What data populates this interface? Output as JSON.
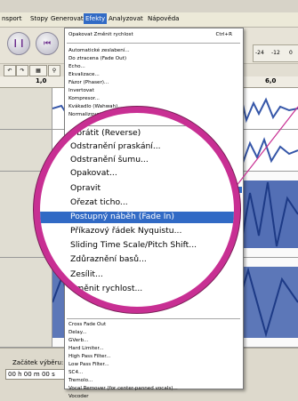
{
  "menubar": {
    "items": [
      "nsport",
      "Stopy",
      "Generovat",
      "Efekty",
      "Analyzovat",
      "Nápověda"
    ]
  },
  "toolbar": {
    "meter_labels": [
      "-24",
      "-12",
      "0"
    ]
  },
  "ruler": {
    "ticks": [
      "1,0",
      "6,0"
    ]
  },
  "status": {
    "start_label": "Začátek výběru:",
    "start_value": "00 h 00 m 00 s"
  },
  "effects_menu": {
    "repeat_last": "Opakovat Změnit rychlost",
    "repeat_shortcut": "Ctrl+R",
    "items_top": [
      "Automatické zeslabení...",
      "Do ztracena (Fade Out)",
      "Echo...",
      "Ekvalizace...",
      "Fázor (Phaser)...",
      "Invertovat",
      "Kompresor...",
      "Kvákadlo (Wahwah)...",
      "Normalizovat..."
    ],
    "items_bottom": [
      "Cross Fade Out",
      "Delay...",
      "GVerb...",
      "Hard Limiter...",
      "High Pass Filter...",
      "Low Pass Filter...",
      "SC4...",
      "Tremolo...",
      "Vocal Remover (for center-panned vocals)...",
      "Vocoder"
    ]
  },
  "magnifier": {
    "items": [
      "Obrátit (Reverse)",
      "Odstranění praskání...",
      "Odstranění šumu...",
      "Opakovat...",
      "Opravit",
      "Ořezat ticho...",
      "Postupný náběh (Fade In)",
      "Příkazový řádek Nyquistu...",
      "Sliding Time Scale/Pitch Shift...",
      "Zdůraznění basů...",
      "Zesílit...",
      "Změnit rychlost..."
    ],
    "highlighted_index": 6
  },
  "colors": {
    "accent_highlight": "#316ac5",
    "magnifier_ring": "#c82f93",
    "waveform": "#3556a8"
  }
}
